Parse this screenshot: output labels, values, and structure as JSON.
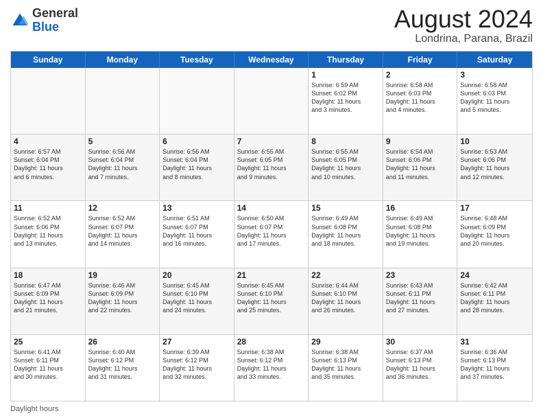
{
  "header": {
    "logo": {
      "general": "General",
      "blue": "Blue"
    },
    "title": "August 2024",
    "subtitle": "Londrina, Parana, Brazil"
  },
  "calendar": {
    "weekdays": [
      "Sunday",
      "Monday",
      "Tuesday",
      "Wednesday",
      "Thursday",
      "Friday",
      "Saturday"
    ],
    "rows": [
      [
        {
          "day": "",
          "text": "",
          "empty": true
        },
        {
          "day": "",
          "text": "",
          "empty": true
        },
        {
          "day": "",
          "text": "",
          "empty": true
        },
        {
          "day": "",
          "text": "",
          "empty": true
        },
        {
          "day": "1",
          "text": "Sunrise: 6:59 AM\nSunset: 6:02 PM\nDaylight: 11 hours\nand 3 minutes.",
          "empty": false
        },
        {
          "day": "2",
          "text": "Sunrise: 6:58 AM\nSunset: 6:03 PM\nDaylight: 11 hours\nand 4 minutes.",
          "empty": false
        },
        {
          "day": "3",
          "text": "Sunrise: 6:58 AM\nSunset: 6:03 PM\nDaylight: 11 hours\nand 5 minutes.",
          "empty": false
        }
      ],
      [
        {
          "day": "4",
          "text": "Sunrise: 6:57 AM\nSunset: 6:04 PM\nDaylight: 11 hours\nand 6 minutes.",
          "empty": false
        },
        {
          "day": "5",
          "text": "Sunrise: 6:56 AM\nSunset: 6:04 PM\nDaylight: 11 hours\nand 7 minutes.",
          "empty": false
        },
        {
          "day": "6",
          "text": "Sunrise: 6:56 AM\nSunset: 6:04 PM\nDaylight: 11 hours\nand 8 minutes.",
          "empty": false
        },
        {
          "day": "7",
          "text": "Sunrise: 6:55 AM\nSunset: 6:05 PM\nDaylight: 11 hours\nand 9 minutes.",
          "empty": false
        },
        {
          "day": "8",
          "text": "Sunrise: 6:55 AM\nSunset: 6:05 PM\nDaylight: 11 hours\nand 10 minutes.",
          "empty": false
        },
        {
          "day": "9",
          "text": "Sunrise: 6:54 AM\nSunset: 6:06 PM\nDaylight: 11 hours\nand 11 minutes.",
          "empty": false
        },
        {
          "day": "10",
          "text": "Sunrise: 6:53 AM\nSunset: 6:06 PM\nDaylight: 11 hours\nand 12 minutes.",
          "empty": false
        }
      ],
      [
        {
          "day": "11",
          "text": "Sunrise: 6:52 AM\nSunset: 6:06 PM\nDaylight: 11 hours\nand 13 minutes.",
          "empty": false
        },
        {
          "day": "12",
          "text": "Sunrise: 6:52 AM\nSunset: 6:07 PM\nDaylight: 11 hours\nand 14 minutes.",
          "empty": false
        },
        {
          "day": "13",
          "text": "Sunrise: 6:51 AM\nSunset: 6:07 PM\nDaylight: 11 hours\nand 16 minutes.",
          "empty": false
        },
        {
          "day": "14",
          "text": "Sunrise: 6:50 AM\nSunset: 6:07 PM\nDaylight: 11 hours\nand 17 minutes.",
          "empty": false
        },
        {
          "day": "15",
          "text": "Sunrise: 6:49 AM\nSunset: 6:08 PM\nDaylight: 11 hours\nand 18 minutes.",
          "empty": false
        },
        {
          "day": "16",
          "text": "Sunrise: 6:49 AM\nSunset: 6:08 PM\nDaylight: 11 hours\nand 19 minutes.",
          "empty": false
        },
        {
          "day": "17",
          "text": "Sunrise: 6:48 AM\nSunset: 6:09 PM\nDaylight: 11 hours\nand 20 minutes.",
          "empty": false
        }
      ],
      [
        {
          "day": "18",
          "text": "Sunrise: 6:47 AM\nSunset: 6:09 PM\nDaylight: 11 hours\nand 21 minutes.",
          "empty": false
        },
        {
          "day": "19",
          "text": "Sunrise: 6:46 AM\nSunset: 6:09 PM\nDaylight: 11 hours\nand 22 minutes.",
          "empty": false
        },
        {
          "day": "20",
          "text": "Sunrise: 6:45 AM\nSunset: 6:10 PM\nDaylight: 11 hours\nand 24 minutes.",
          "empty": false
        },
        {
          "day": "21",
          "text": "Sunrise: 6:45 AM\nSunset: 6:10 PM\nDaylight: 11 hours\nand 25 minutes.",
          "empty": false
        },
        {
          "day": "22",
          "text": "Sunrise: 6:44 AM\nSunset: 6:10 PM\nDaylight: 11 hours\nand 26 minutes.",
          "empty": false
        },
        {
          "day": "23",
          "text": "Sunrise: 6:43 AM\nSunset: 6:11 PM\nDaylight: 11 hours\nand 27 minutes.",
          "empty": false
        },
        {
          "day": "24",
          "text": "Sunrise: 6:42 AM\nSunset: 6:11 PM\nDaylight: 11 hours\nand 28 minutes.",
          "empty": false
        }
      ],
      [
        {
          "day": "25",
          "text": "Sunrise: 6:41 AM\nSunset: 6:11 PM\nDaylight: 11 hours\nand 30 minutes.",
          "empty": false
        },
        {
          "day": "26",
          "text": "Sunrise: 6:40 AM\nSunset: 6:12 PM\nDaylight: 11 hours\nand 31 minutes.",
          "empty": false
        },
        {
          "day": "27",
          "text": "Sunrise: 6:39 AM\nSunset: 6:12 PM\nDaylight: 11 hours\nand 32 minutes.",
          "empty": false
        },
        {
          "day": "28",
          "text": "Sunrise: 6:38 AM\nSunset: 6:12 PM\nDaylight: 11 hours\nand 33 minutes.",
          "empty": false
        },
        {
          "day": "29",
          "text": "Sunrise: 6:38 AM\nSunset: 6:13 PM\nDaylight: 11 hours\nand 35 minutes.",
          "empty": false
        },
        {
          "day": "30",
          "text": "Sunrise: 6:37 AM\nSunset: 6:13 PM\nDaylight: 11 hours\nand 36 minutes.",
          "empty": false
        },
        {
          "day": "31",
          "text": "Sunrise: 6:36 AM\nSunset: 6:13 PM\nDaylight: 11 hours\nand 37 minutes.",
          "empty": false
        }
      ]
    ]
  },
  "footer": {
    "note": "Daylight hours"
  },
  "colors": {
    "header_bg": "#1565c0",
    "header_text": "#ffffff",
    "border": "#cccccc",
    "alt_bg": "#f5f5f5"
  }
}
